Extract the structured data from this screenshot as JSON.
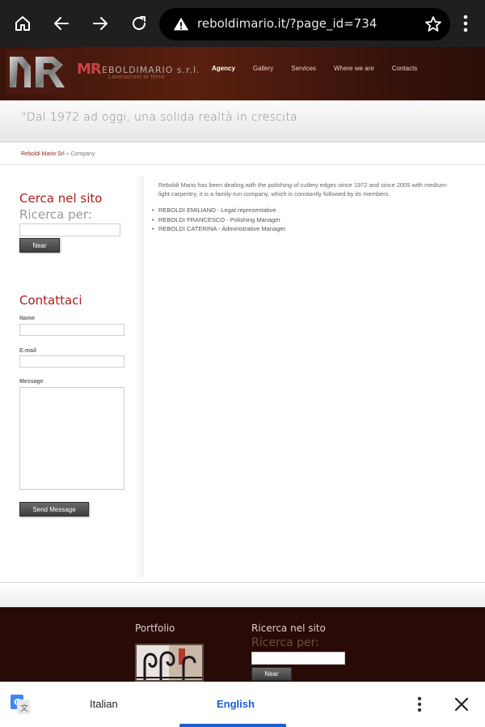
{
  "browser": {
    "url": "reboldimario.it/?page_id=734",
    "icons": [
      "home-icon",
      "back-icon",
      "forward-icon",
      "reload-icon",
      "warning-icon",
      "star-icon",
      "more-vert-icon"
    ]
  },
  "site": {
    "logo": {
      "mark": "MR",
      "name": "EBOLDIMARIO s.r.l.",
      "tagline": "Lavorazioni in ferro"
    },
    "nav": [
      "Agency",
      "Gallery",
      "Services",
      "Where we are",
      "Contacts"
    ],
    "tagline": "\"Dal 1972 ad oggi, una solida realtà in crescita",
    "breadcrumb": {
      "home": "Reboldi Mario Srl",
      "separator": " » ",
      "current": "Company"
    }
  },
  "sidebar": {
    "search": {
      "title": "Cerca nel sito",
      "subtitle": "Ricerca per:",
      "button": "Near"
    },
    "contact": {
      "title": "Contattaci",
      "name_label": "Name",
      "email_label": "E-mail",
      "message_label": "Message",
      "button": "Send Message"
    }
  },
  "content": {
    "intro": "Reboldi Mario has been dealing with the polishing of cutlery edges since 1972 and since 2005 with medium-light carpentry, it is a family-run company, which is constantly followed by its members.",
    "team": [
      "REBOLDI EMILIANO - Legal representative",
      "REBOLDI FRANCESCO  - Polishing Manager",
      "REBOLDI CATERINA  -  Administrative Manager"
    ]
  },
  "footer": {
    "portfolio_title": "Portfolio",
    "search_title": "Ricerca nel sito",
    "search_subtitle": "Ricerca per:",
    "search_button": "Near"
  },
  "translate": {
    "source": "Italian",
    "target": "English",
    "accent": "#1a5fd1"
  }
}
